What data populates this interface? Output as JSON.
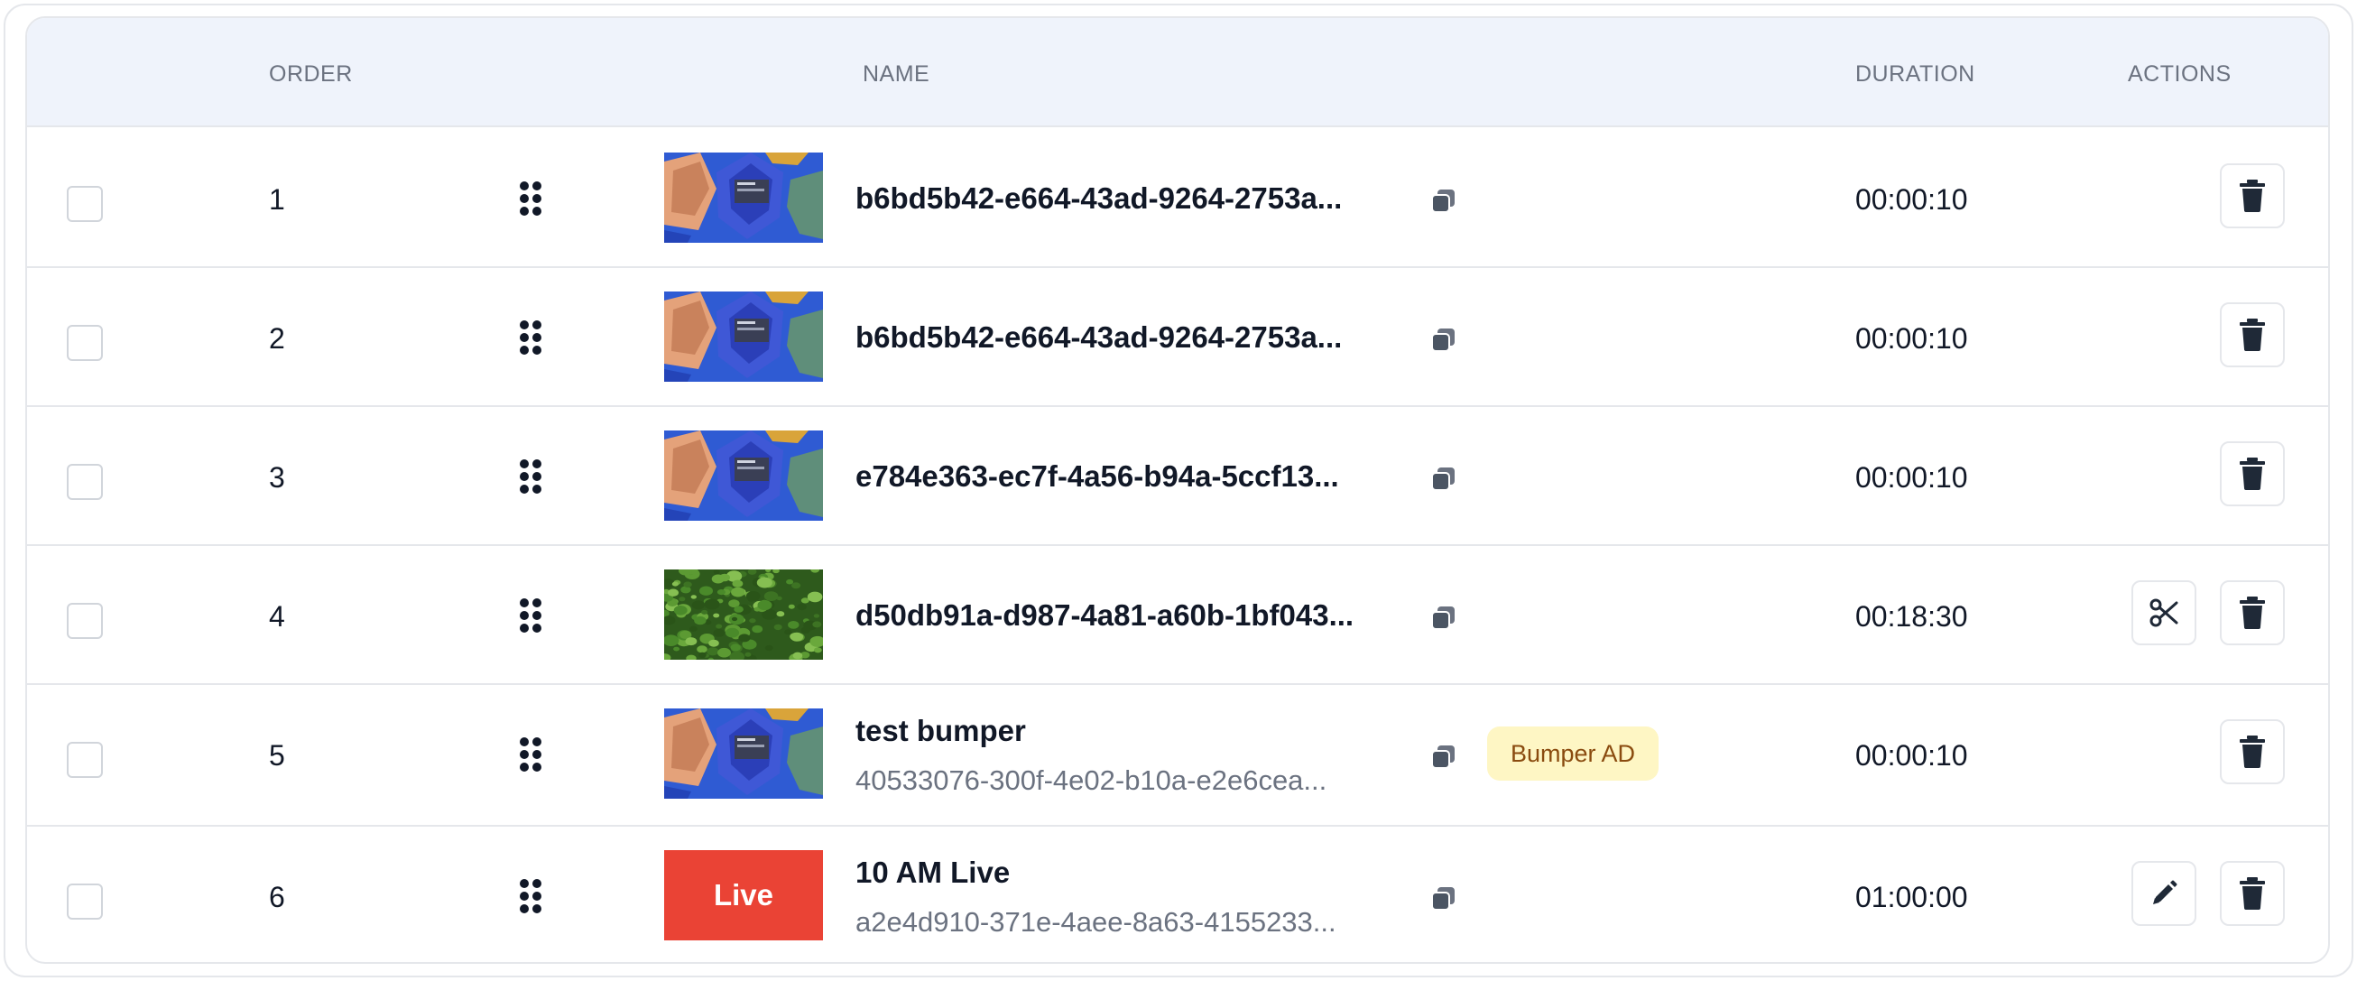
{
  "headers": {
    "order": "ORDER",
    "name": "NAME",
    "duration": "DURATION",
    "actions": "ACTIONS"
  },
  "rows": [
    {
      "order": "1",
      "title": "b6bd5b42-e664-43ad-9264-2753a...",
      "subtitle": "",
      "badge": "",
      "duration": "00:00:10",
      "thumbnail": "umbrellas",
      "thumb_text": "",
      "extra_action": ""
    },
    {
      "order": "2",
      "title": "b6bd5b42-e664-43ad-9264-2753a...",
      "subtitle": "",
      "badge": "",
      "duration": "00:00:10",
      "thumbnail": "umbrellas",
      "thumb_text": "",
      "extra_action": ""
    },
    {
      "order": "3",
      "title": "e784e363-ec7f-4a56-b94a-5ccf13...",
      "subtitle": "",
      "badge": "",
      "duration": "00:00:10",
      "thumbnail": "umbrellas",
      "thumb_text": "",
      "extra_action": ""
    },
    {
      "order": "4",
      "title": "d50db91a-d987-4a81-a60b-1bf043...",
      "subtitle": "",
      "badge": "",
      "duration": "00:18:30",
      "thumbnail": "leaves",
      "thumb_text": "",
      "extra_action": "scissors-icon"
    },
    {
      "order": "5",
      "title": "test bumper",
      "subtitle": "40533076-300f-4e02-b10a-e2e6cea...",
      "badge": "Bumper AD",
      "duration": "00:00:10",
      "thumbnail": "umbrellas",
      "thumb_text": "",
      "extra_action": ""
    },
    {
      "order": "6",
      "title": "10 AM Live",
      "subtitle": "a2e4d910-371e-4aee-8a63-4155233...",
      "badge": "",
      "duration": "01:00:00",
      "thumbnail": "live",
      "thumb_text": "Live",
      "extra_action": "pencil-icon"
    }
  ],
  "colors": {
    "header_bg": "#eff3fb",
    "live_red": "#ea4335",
    "badge_bg": "#fef6c4",
    "badge_text": "#8a4b0f"
  },
  "icons": [
    "drag-handle-icon",
    "copy-icon",
    "trash-icon",
    "scissors-icon",
    "pencil-icon"
  ]
}
